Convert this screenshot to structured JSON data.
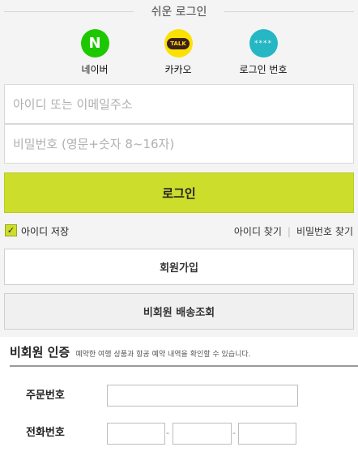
{
  "easy_login": {
    "title": "쉬운 로그인",
    "options": [
      {
        "label": "네이버",
        "icon": "naver-icon",
        "glyph": "N",
        "color": "#1ec800"
      },
      {
        "label": "카카오",
        "icon": "kakao-talk-icon",
        "glyph": "TALK",
        "color": "#fae100"
      },
      {
        "label": "로그인 번호",
        "icon": "pin-icon",
        "glyph": "****",
        "color": "#25b7c3"
      }
    ]
  },
  "form": {
    "id_placeholder": "아이디 또는 이메일주소",
    "password_placeholder": "비밀번호 (영문+숫자 8~16자)",
    "login_label": "로그인",
    "save_id_label": "아이디 저장",
    "save_id_checked": true,
    "find_id_label": "아이디 찾기",
    "find_password_label": "비밀번호 찾기",
    "accent_color": "#cddd2c"
  },
  "buttons": {
    "join_label": "회원가입",
    "nonmember_label": "비회원 배송조회"
  },
  "certification": {
    "title": "비회원 인증",
    "description": "예약한 여행 상품과 항공 예약 내역을 확인할 수 있습니다.",
    "order_label": "주문번호",
    "phone_label": "전화번호",
    "separator": "-"
  }
}
